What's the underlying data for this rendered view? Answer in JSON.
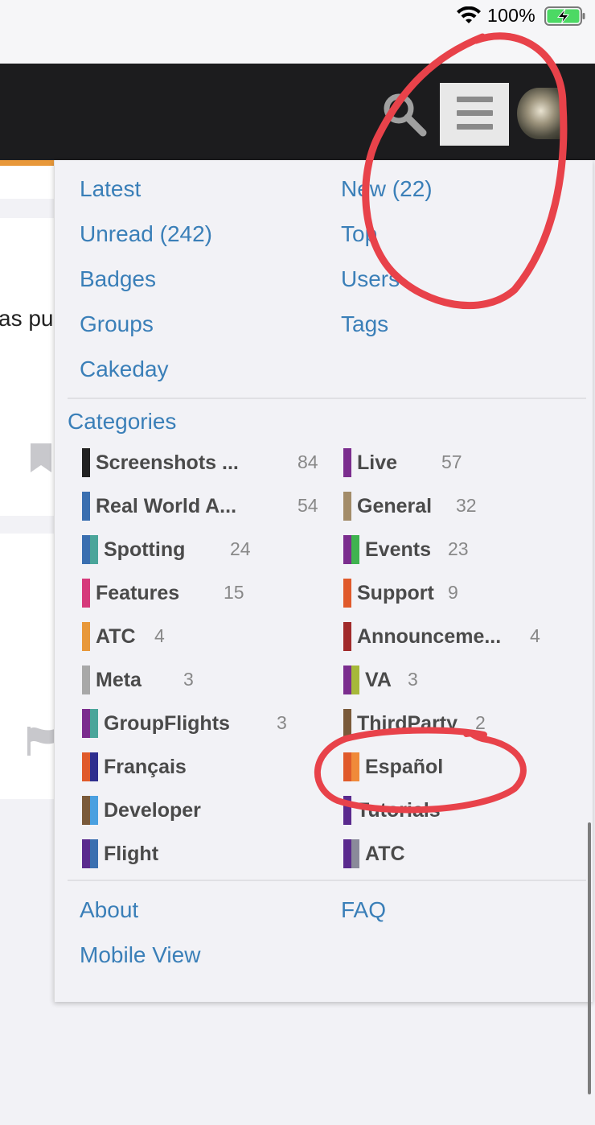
{
  "status_bar": {
    "battery_percent": "100%",
    "icons": [
      "wifi-icon",
      "battery-charging-icon"
    ]
  },
  "header": {
    "icons": [
      "search-icon",
      "hamburger-menu-icon",
      "user-avatar"
    ]
  },
  "background": {
    "partial_text": "as pu",
    "icons": [
      "bookmark-icon",
      "flag-icon"
    ],
    "accent_color": "#e8983a"
  },
  "menu": {
    "nav_links": {
      "latest": "Latest",
      "new": "New (22)",
      "unread": "Unread (242)",
      "top": "Top",
      "badges": "Badges",
      "users": "Users",
      "groups": "Groups",
      "tags": "Tags",
      "cakeday": "Cakeday"
    },
    "categories_heading": "Categories",
    "categories": [
      {
        "name": "Screenshots ...",
        "count": "84",
        "colors": [
          "#222222"
        ]
      },
      {
        "name": "Live",
        "count": "57",
        "colors": [
          "#7b2d8e"
        ]
      },
      {
        "name": "Real World A...",
        "count": "54",
        "colors": [
          "#3a6fb0"
        ]
      },
      {
        "name": "General",
        "count": "32",
        "colors": [
          "#a38c69"
        ]
      },
      {
        "name": "Spotting",
        "count": "24",
        "colors": [
          "#3a6fb0",
          "#4aa59a"
        ]
      },
      {
        "name": "Events",
        "count": "23",
        "colors": [
          "#7b2d8e",
          "#3fb34f"
        ]
      },
      {
        "name": "Features",
        "count": "15",
        "colors": [
          "#d63a7b"
        ]
      },
      {
        "name": "Support",
        "count": "9",
        "colors": [
          "#e05a2b"
        ]
      },
      {
        "name": "ATC",
        "count": "4",
        "colors": [
          "#e8983a"
        ]
      },
      {
        "name": "Announceme...",
        "count": "4",
        "colors": [
          "#a02a2a"
        ]
      },
      {
        "name": "Meta",
        "count": "3",
        "colors": [
          "#a8a8a8"
        ]
      },
      {
        "name": "VA",
        "count": "3",
        "colors": [
          "#7b2d8e",
          "#a6b83a"
        ]
      },
      {
        "name": "GroupFlights",
        "count": "3",
        "colors": [
          "#7b2d8e",
          "#4aa59a"
        ]
      },
      {
        "name": "ThirdParty",
        "count": "2",
        "colors": [
          "#7a5a3a"
        ]
      },
      {
        "name": "Français",
        "count": "",
        "colors": [
          "#e05a2b",
          "#2e2e8e"
        ]
      },
      {
        "name": "Español",
        "count": "",
        "colors": [
          "#e05a2b",
          "#f08a3a"
        ]
      },
      {
        "name": "Developer",
        "count": "",
        "colors": [
          "#7a5a3a",
          "#4aa0e0"
        ]
      },
      {
        "name": "Tutorials",
        "count": "",
        "colors": [
          "#5a2a8e"
        ]
      },
      {
        "name": "Flight",
        "count": "",
        "colors": [
          "#5a2a8e",
          "#3a6fb0"
        ]
      },
      {
        "name": "ATC",
        "count": "",
        "colors": [
          "#5a2a8e",
          "#8a8a9a"
        ]
      }
    ],
    "footer_links": {
      "about": "About",
      "faq": "FAQ",
      "mobile_view": "Mobile View"
    }
  },
  "annotation_color": "#e8424a"
}
